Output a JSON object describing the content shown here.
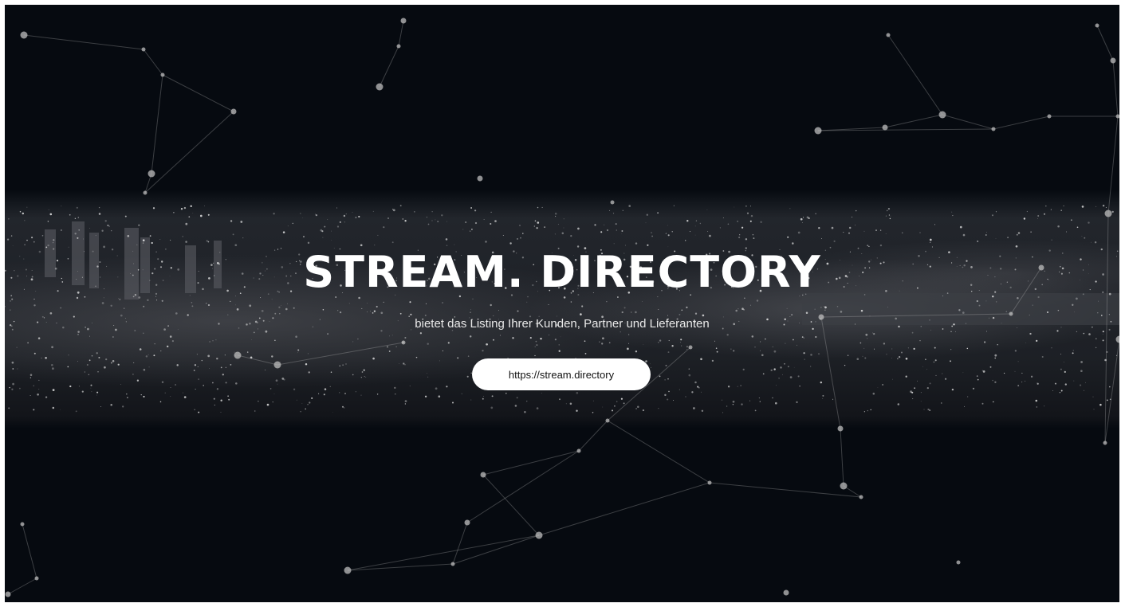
{
  "hero": {
    "title": "STREAM. DIRECTORY",
    "subtitle": "bietet das Listing Ihrer Kunden, Partner und Lieferanten",
    "button_label": "https://stream.directory"
  },
  "colors": {
    "background": "#060a10",
    "text": "#ffffff",
    "button_background": "#ffffff",
    "button_text": "#111111"
  }
}
